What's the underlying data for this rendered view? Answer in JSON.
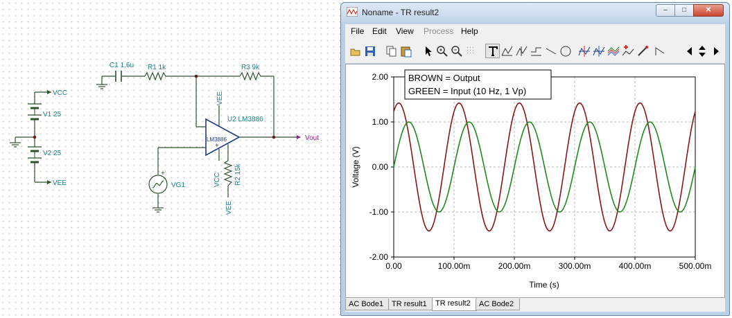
{
  "schematic": {
    "labels": {
      "vcc": "VCC",
      "vee": "VEE",
      "v1": "V1 25",
      "v2": "V2 25",
      "c1": "C1 1.6u",
      "r1": "R1 1k",
      "r3": "R3 9k",
      "u2": "U2 LM3886",
      "opamp": "LM3886",
      "vout": "Vout",
      "vg1": "VG1",
      "r2": "R2 15k",
      "pin_vee_top": "VEE",
      "pin_vcc_bottom": "VCC",
      "r2_vee": "VEE",
      "minus": "-",
      "plus": "+"
    }
  },
  "window": {
    "title": "Noname - TR result2",
    "controls": {
      "minimize": "–",
      "maximize": "□",
      "close": "✕"
    }
  },
  "menu": {
    "file": "File",
    "edit": "Edit",
    "view": "View",
    "process": "Process",
    "help": "Help"
  },
  "toolbar": {
    "icons": [
      "open-icon",
      "save-icon",
      "copy-icon",
      "paste-icon",
      "pointer-icon",
      "zoom-in-icon",
      "zoom-100-icon",
      "grid-icon",
      "text-icon",
      "cursor-a-icon",
      "cursor-b-icon",
      "tangent-icon",
      "line-icon",
      "ellipse-icon",
      "cursor-a-cross-icon",
      "cursor-b-cross-icon",
      "add-curve-icon",
      "add-marker-icon",
      "pen-icon",
      "step-icon",
      "scroll-left-icon",
      "scroll-updown-icon",
      "scroll-right-icon"
    ]
  },
  "colors": {
    "output": "#8b1414",
    "input": "#1e8a1e",
    "schematic_teal": "#1b7f86",
    "wire": "#2f4f2f"
  },
  "chart_data": {
    "type": "line",
    "legend_lines": [
      "BROWN = Output",
      "GREEN = Input (10 Hz, 1 Vp)"
    ],
    "xlabel": "Time (s)",
    "ylabel": "Voltage (V)",
    "xlim": [
      0,
      0.5
    ],
    "ylim": [
      -2,
      2
    ],
    "x_ticks": [
      0,
      0.1,
      0.2,
      0.3,
      0.4,
      0.5
    ],
    "x_tick_labels": [
      "0.00",
      "100.00m",
      "200.00m",
      "300.00m",
      "400.00m",
      "500.00m"
    ],
    "y_ticks": [
      2,
      1,
      0,
      -1,
      -2
    ],
    "y_tick_labels": [
      "2.00",
      "1.00",
      "0.00",
      "-1.00",
      "-2.00"
    ],
    "grid": true,
    "series": [
      {
        "name": "Output",
        "color": "#8b1414",
        "amplitude": 1.42,
        "frequency_hz": 10,
        "phase_deg": 60
      },
      {
        "name": "Input",
        "color": "#1e8a1e",
        "amplitude": 1.0,
        "frequency_hz": 10,
        "phase_deg": 0
      }
    ]
  },
  "tabs": [
    {
      "label": "AC Bode1",
      "active": false
    },
    {
      "label": "TR result1",
      "active": false
    },
    {
      "label": "TR result2",
      "active": true
    },
    {
      "label": "AC Bode2",
      "active": false
    }
  ]
}
